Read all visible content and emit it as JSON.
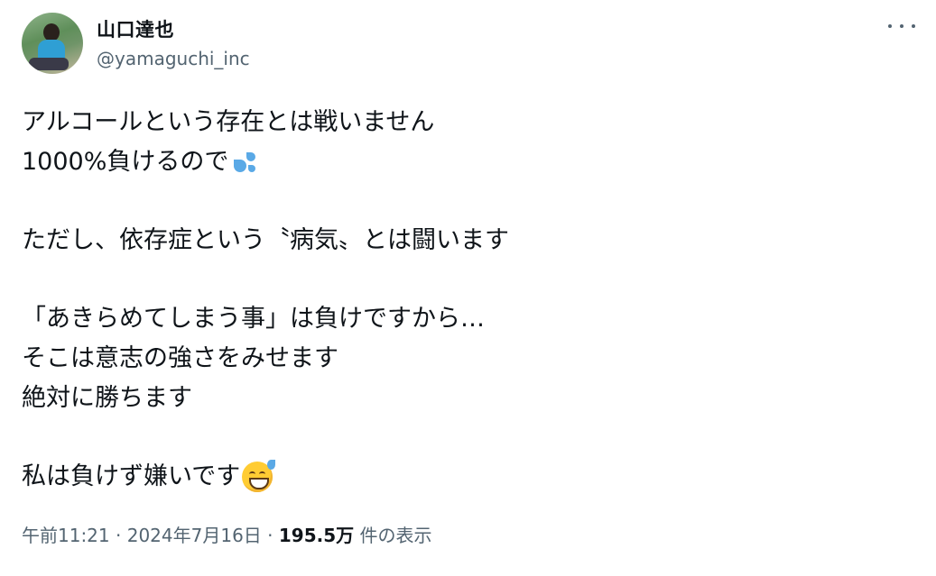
{
  "tweet": {
    "author": {
      "name": "山口達也",
      "handle": "@yamaguchi_inc"
    },
    "lines": [
      "アルコールという存在とは戦いません",
      "1000%負けるので",
      "",
      "ただし、依存症という〝病気〟とは闘います",
      "",
      "「あきらめてしまう事」は負けですから…",
      "そこは意志の強さをみせます",
      "絶対に勝ちます",
      "",
      "私は負けず嫌いです"
    ],
    "emojis": {
      "line2": "sweat-droplets-emoji",
      "line10": "grinning-face-with-sweat-emoji"
    },
    "meta": {
      "time": "午前11:21",
      "separator1": " · ",
      "date": "2024年7月16日",
      "separator2": " · ",
      "views": "195.5万",
      "views_suffix": " 件の表示"
    }
  }
}
